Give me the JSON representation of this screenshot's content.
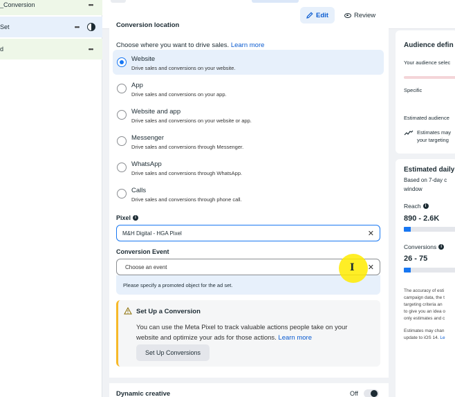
{
  "tree": {
    "rows": [
      {
        "label": "_Conversion",
        "menu": "•••"
      },
      {
        "label": "Set",
        "menu": "•••"
      },
      {
        "label": "d",
        "menu": "•••"
      }
    ]
  },
  "header": {
    "edit_label": "Edit",
    "review_label": "Review"
  },
  "conversion_location": {
    "section_title": "Conversion location",
    "instruction": "Choose where you want to drive sales.",
    "learn_more": "Learn more",
    "selected": "Website",
    "options": [
      {
        "title": "Website",
        "description": "Drive sales and conversions on your website."
      },
      {
        "title": "App",
        "description": "Drive sales and conversions on your app."
      },
      {
        "title": "Website and app",
        "description": "Drive sales and conversions on your website or app."
      },
      {
        "title": "Messenger",
        "description": "Drive sales and conversions through Messenger."
      },
      {
        "title": "WhatsApp",
        "description": "Drive sales and conversions through WhatsApp."
      },
      {
        "title": "Calls",
        "description": "Drive sales and conversions through phone call."
      }
    ]
  },
  "pixel": {
    "label": "Pixel",
    "value": "M&H Digital - HGA Pixel"
  },
  "conversion_event": {
    "label": "Conversion Event",
    "placeholder": "Choose an event",
    "error": "Please specify a promoted object for the ad set."
  },
  "setup_conversion": {
    "title": "Set Up a Conversion",
    "body": "You can use the Meta Pixel to track valuable actions people take on your website and optimize your ads for those actions.",
    "learn_more": "Learn more",
    "button": "Set Up Conversions"
  },
  "dynamic_creative": {
    "title": "Dynamic creative",
    "state": "Off"
  },
  "audience_panel": {
    "title": "Audience defin",
    "line1": "Your audience selec",
    "specific": "Specific",
    "estimated": "Estimated audience",
    "note_line1": "Estimates may",
    "note_line2": "your targeting"
  },
  "daily_results": {
    "title": "Estimated daily",
    "sub_line1": "Based on 7-day c",
    "sub_line2": "window",
    "reach_label": "Reach",
    "reach_value": "890 - 2.6K",
    "reach_fill": 0.12,
    "conversions_label": "Conversions",
    "conversions_value": "26 - 75",
    "conversions_fill": 0.12,
    "fine1": [
      "The accuracy of esti",
      "campaign data, the t",
      "targeting criteria an",
      "to give you an idea o",
      "only estimates and c"
    ],
    "fine2_line1": "Estimates may chan",
    "fine2_line2": "update to iOS 14.",
    "fine2_link": "Le"
  },
  "colors": {
    "accent": "#1877f2",
    "link": "#0a5bd0",
    "warning": "#f7b928",
    "cursor_highlight": "#ffeb00"
  }
}
